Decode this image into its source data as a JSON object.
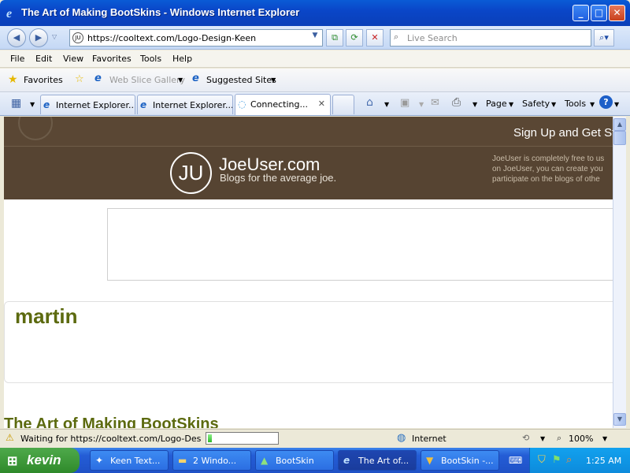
{
  "window": {
    "title": "The Art of Making BootSkins - Windows Internet Explorer",
    "controls": {
      "minimize": "_",
      "maximize": "□",
      "close": "✕"
    }
  },
  "address_bar": {
    "url": "https://cooltext.com/Logo-Design-Keen",
    "favicon_text": "JU",
    "search_placeholder": "Live Search"
  },
  "menu": {
    "items": [
      "File",
      "Edit",
      "View",
      "Favorites",
      "Tools",
      "Help"
    ]
  },
  "favorites_bar": {
    "favorites_label": "Favorites",
    "items": [
      "Web Slice Gallery",
      "Suggested Sites"
    ]
  },
  "tabs": [
    {
      "label": "Internet Explorer...",
      "icon": "ie-icon"
    },
    {
      "label": "Internet Explorer...",
      "icon": "ie-icon"
    },
    {
      "label": "Connecting...",
      "icon": "loading-icon",
      "active": true
    }
  ],
  "command_bar": {
    "page_label": "Page",
    "safety_label": "Safety",
    "tools_label": "Tools"
  },
  "page": {
    "signup_text": "Sign Up and Get St",
    "logo_text": "JU",
    "site_name": "JoeUser.com",
    "tagline": "Blogs for the average joe.",
    "blurb_lines": [
      "JoeUser is completely free to us",
      "on JoeUser, you can create you",
      "participate on the blogs of othe"
    ],
    "username": "martin",
    "post_title": "The Art of Making BootSkins"
  },
  "status_bar": {
    "text": "Waiting for https://cooltext.com/Logo-Design-Ki",
    "progress": 0.06,
    "zone": "Internet",
    "zoom": "100%"
  },
  "taskbar": {
    "start_label": "kevin",
    "tasks": [
      {
        "label": "Keen Text...",
        "icon": "app-icon"
      },
      {
        "label": "2 Windo...",
        "icon": "folder-icon"
      },
      {
        "label": "BootSkin",
        "icon": "bootskin-icon"
      },
      {
        "label": "The Art of...",
        "icon": "ie-icon",
        "active": true
      },
      {
        "label": "BootSkin -...",
        "icon": "bootskin-icon"
      }
    ],
    "clock": "1:25 AM"
  },
  "colors": {
    "titlebar": "#0a46c8",
    "header_brown": "#564432",
    "username_olive": "#5c6a0f",
    "taskbar_blue": "#245dd6",
    "start_green": "#3a9a36"
  }
}
